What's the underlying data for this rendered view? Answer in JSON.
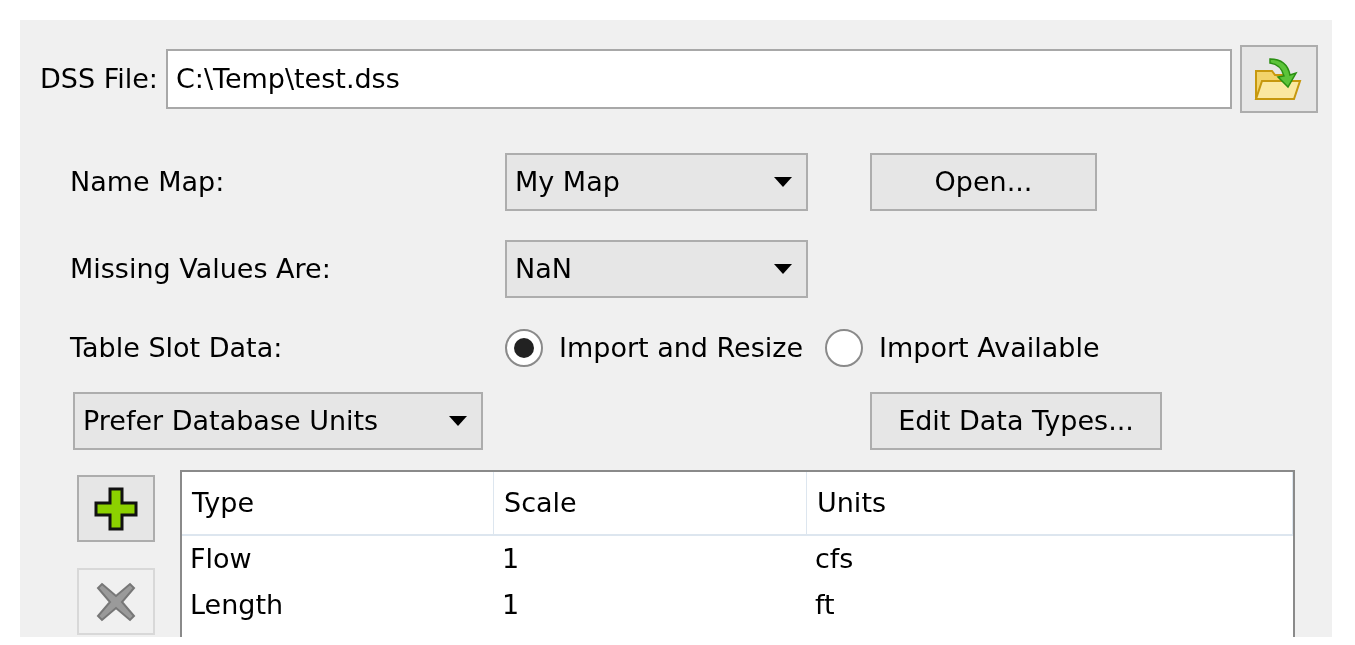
{
  "dss_file": {
    "label": "DSS File:",
    "value": "C:\\Temp\\test.dss"
  },
  "name_map": {
    "label": "Name Map:",
    "value": "My Map",
    "button": "Open..."
  },
  "missing_values": {
    "label": "Missing Values Are:",
    "value": "NaN"
  },
  "table_slot_data": {
    "label": "Table Slot Data:",
    "options": [
      {
        "label": "Import and Resize",
        "selected": true
      },
      {
        "label": "Import Available",
        "selected": false
      }
    ]
  },
  "units_mode": {
    "value": "Prefer Database Units"
  },
  "edit_data_types_button": "Edit Data Types...",
  "toolbar": [
    {
      "kind": "add",
      "disabled": false
    },
    {
      "kind": "remove",
      "disabled": true
    }
  ],
  "table": {
    "columns": [
      "Type",
      "Scale",
      "Units"
    ],
    "rows": [
      [
        "Flow",
        "1",
        "cfs"
      ],
      [
        "Length",
        "1",
        "ft"
      ]
    ]
  }
}
